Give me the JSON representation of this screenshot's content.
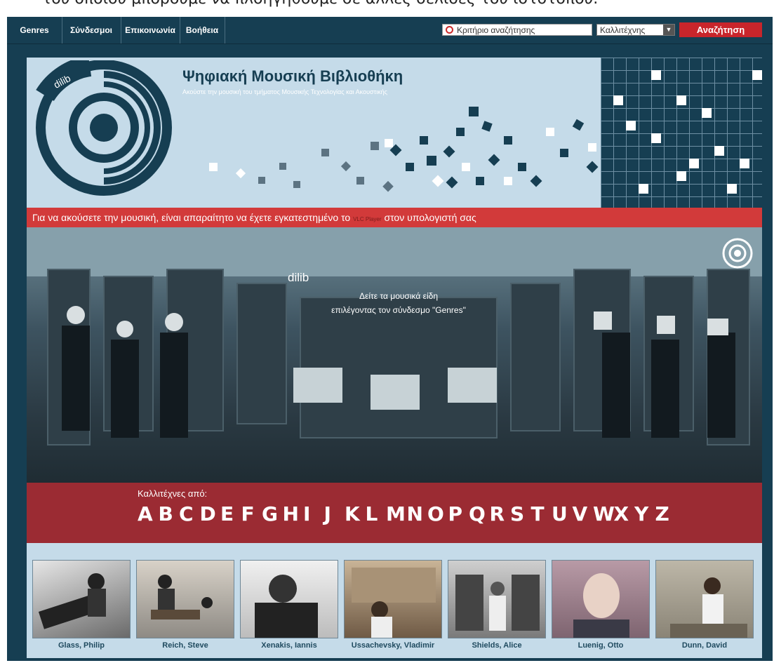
{
  "caption": "του οποίου μπορούμε να πλοηγηθούμε σε άλλες σελίδες του ιστοτόπου.",
  "nav": {
    "items": [
      {
        "label": "Genres"
      },
      {
        "label": "Σύνδεσμοι"
      },
      {
        "label": "Επικοινωνία"
      },
      {
        "label": "Βοήθεια"
      }
    ],
    "search_placeholder": "Κριτήριο αναζήτησης",
    "select_value": "Καλλιτέχνης",
    "search_button": "Αναζήτηση"
  },
  "banner": {
    "logo_text": "dilib",
    "title": "Ψηφιακή Μουσική Βιβλιοθήκη",
    "subtitle": "Ακούστε την μουσική του τμήματος Μουσικής Τεχνολογίας και Ακουστικής"
  },
  "notice": {
    "text_before": "Για να ακούσετε την μουσική, είναι απαραίτητο να έχετε εγκατεστημένο το",
    "link": "VLC Player",
    "text_after": "στον υπολογιστή σας"
  },
  "hero": {
    "brand": "dilib",
    "line1": "Δείτε τα μουσικά είδη",
    "line2": "επιλέγοντας τον σύνδεσμο \"Genres\""
  },
  "alphabet": {
    "label": "Καλλιτέχνες από:",
    "letters": [
      "A",
      "B",
      "C",
      "D",
      "E",
      "F",
      "G",
      "H",
      "I",
      "J",
      "K",
      "L",
      "M",
      "N",
      "O",
      "P",
      "Q",
      "R",
      "S",
      "T",
      "U",
      "V",
      "W",
      "X",
      "Y",
      "Z"
    ]
  },
  "artists": [
    {
      "name": "Glass, Philip"
    },
    {
      "name": "Reich, Steve"
    },
    {
      "name": "Xenakis, Iannis"
    },
    {
      "name": "Ussachevsky, Vladimir"
    },
    {
      "name": "Shields, Alice"
    },
    {
      "name": "Luenig, Otto"
    },
    {
      "name": "Dunn, David"
    }
  ],
  "colors": {
    "frame": "#163e52",
    "accent_red": "#c8252b",
    "band_red": "#9b2b33",
    "light_blue": "#c5dbe9"
  }
}
